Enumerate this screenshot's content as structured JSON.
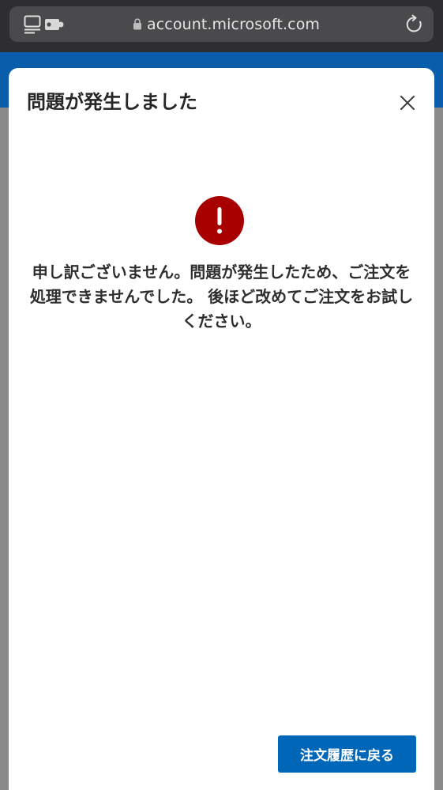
{
  "browser": {
    "url": "account.microsoft.com",
    "icons": [
      "tab-overview-icon",
      "extension-icon",
      "lock-icon",
      "reload-icon"
    ]
  },
  "dialog": {
    "title": "問題が発生しました",
    "message": "申し訳ございません。問題が発生したため、ご注文を処理できませんでした。 後ほど改めてご注文をお試しください。",
    "back_button_label": "注文履歴に戻る",
    "icons": [
      "close-icon",
      "error-icon"
    ]
  },
  "colors": {
    "accent_blue": "#0067b8",
    "header_blue": "#0a5dab",
    "error_red": "#a80000",
    "browser_bar": "#2e2e30",
    "overlay_gray": "#8a8a8a"
  }
}
